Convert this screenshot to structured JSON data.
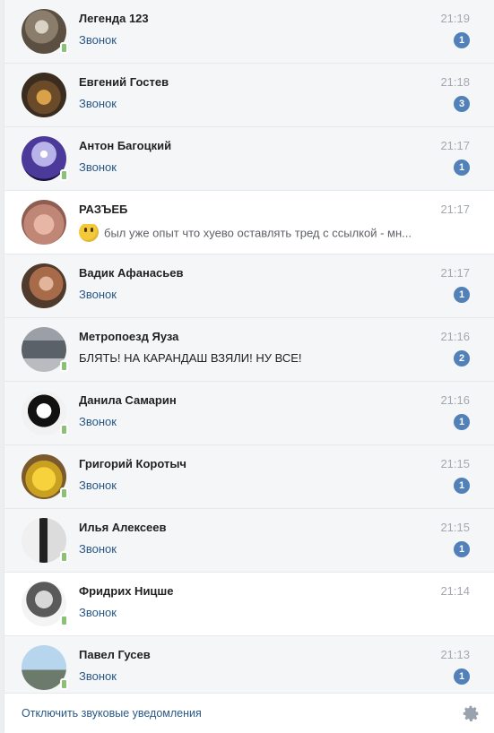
{
  "dialogs": [
    {
      "name": "Легенда 123",
      "time": "21:19",
      "preview": "Звонок",
      "badge": "1",
      "online_mobile": true,
      "read": false,
      "preview_style": "link"
    },
    {
      "name": "Евгений Гостев",
      "time": "21:18",
      "preview": "Звонок",
      "badge": "3",
      "online_mobile": false,
      "read": false,
      "preview_style": "link"
    },
    {
      "name": "Антон Багоцкий",
      "time": "21:17",
      "preview": "Звонок",
      "badge": "1",
      "online_mobile": true,
      "read": false,
      "preview_style": "link"
    },
    {
      "name": "РАЗЪЕБ",
      "time": "21:17",
      "preview": "был уже опыт что хуево оставлять тред с ссылкой - мн...",
      "badge": "",
      "online_mobile": false,
      "read": true,
      "preview_style": "muted",
      "has_emoji": true
    },
    {
      "name": "Вадик Афанасьев",
      "time": "21:17",
      "preview": "Звонок",
      "badge": "1",
      "online_mobile": false,
      "read": false,
      "preview_style": "link"
    },
    {
      "name": "Метропоезд Яуза",
      "time": "21:16",
      "preview": "БЛЯТЬ! НА КАРАНДАШ ВЗЯЛИ! НУ ВСЕ!",
      "badge": "2",
      "online_mobile": true,
      "read": false,
      "preview_style": "text"
    },
    {
      "name": "Данила Самарин",
      "time": "21:16",
      "preview": "Звонок",
      "badge": "1",
      "online_mobile": true,
      "read": false,
      "preview_style": "link"
    },
    {
      "name": "Григорий Коротыч",
      "time": "21:15",
      "preview": "Звонок",
      "badge": "1",
      "online_mobile": true,
      "read": false,
      "preview_style": "link"
    },
    {
      "name": "Илья Алексеев",
      "time": "21:15",
      "preview": "Звонок",
      "badge": "1",
      "online_mobile": true,
      "read": false,
      "preview_style": "link"
    },
    {
      "name": "Фридрих Ницше",
      "time": "21:14",
      "preview": "Звонок",
      "badge": "",
      "online_mobile": true,
      "read": true,
      "preview_style": "link"
    },
    {
      "name": "Павел Гусев",
      "time": "21:13",
      "preview": "Звонок",
      "badge": "1",
      "online_mobile": true,
      "read": false,
      "preview_style": "link"
    }
  ],
  "footer": {
    "mute_link": "Отключить звуковые уведомления",
    "settings_icon": "gear-icon"
  },
  "colors": {
    "link": "#2a5885",
    "badge": "#5181b8",
    "time": "#a3a8b0",
    "unread_bg": "#f5f6f8",
    "online": "#8ac176"
  }
}
